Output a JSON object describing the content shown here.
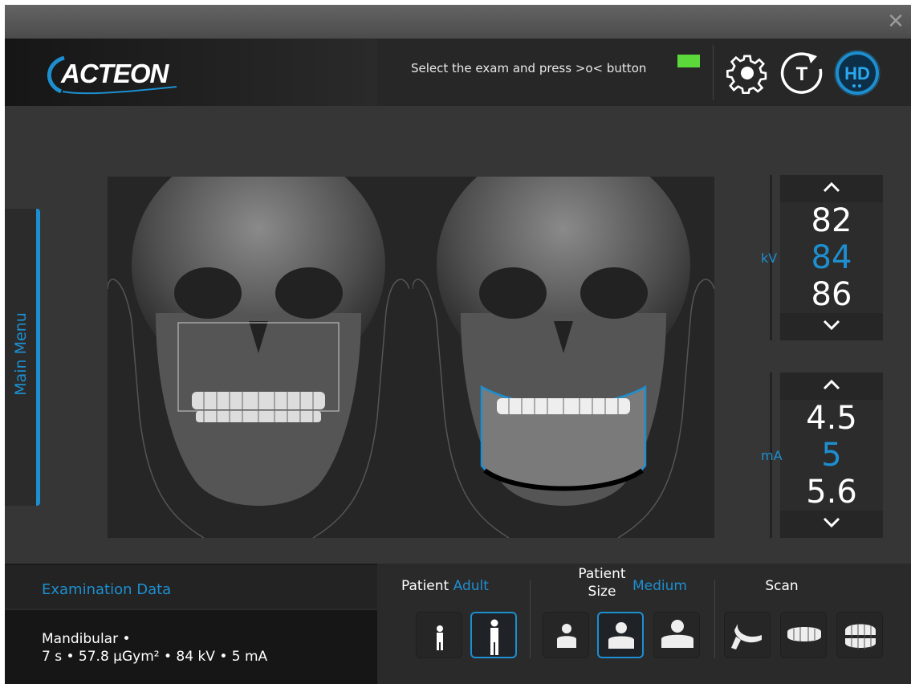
{
  "window": {
    "close_icon": "close-icon"
  },
  "header": {
    "logo_text": "ACTEON",
    "instruction": "Select the exam and press >o< button",
    "ready_color": "#5cd93a",
    "icons": [
      "gear-icon",
      "timer-t-icon",
      "hd-icon"
    ]
  },
  "sidebar": {
    "main_menu_label": "Main Menu"
  },
  "kv": {
    "unit": "kV",
    "values": [
      "82",
      "84",
      "86"
    ],
    "selected": "84"
  },
  "ma": {
    "unit": "mA",
    "values": [
      "4.5",
      "5",
      "5.6"
    ],
    "selected": "5"
  },
  "exam_data": {
    "title": "Examination Data",
    "line1": "Mandibular •",
    "line2": "7 s • 57.8 µGym² • 84 kV • 5 mA"
  },
  "patient": {
    "label": "Patient",
    "value": "Adult",
    "options": [
      "child-icon",
      "adult-icon"
    ]
  },
  "patient_size": {
    "label_line1": "Patient",
    "label_line2": "Size",
    "value": "Medium",
    "options": [
      "small-person-icon",
      "medium-person-icon",
      "large-person-icon"
    ]
  },
  "scan": {
    "label": "Scan",
    "options": [
      "bite-block-icon",
      "dental-arch-icon",
      "jaw-model-icon"
    ]
  },
  "colors": {
    "accent": "#1d8fd0",
    "background": "#363636"
  }
}
